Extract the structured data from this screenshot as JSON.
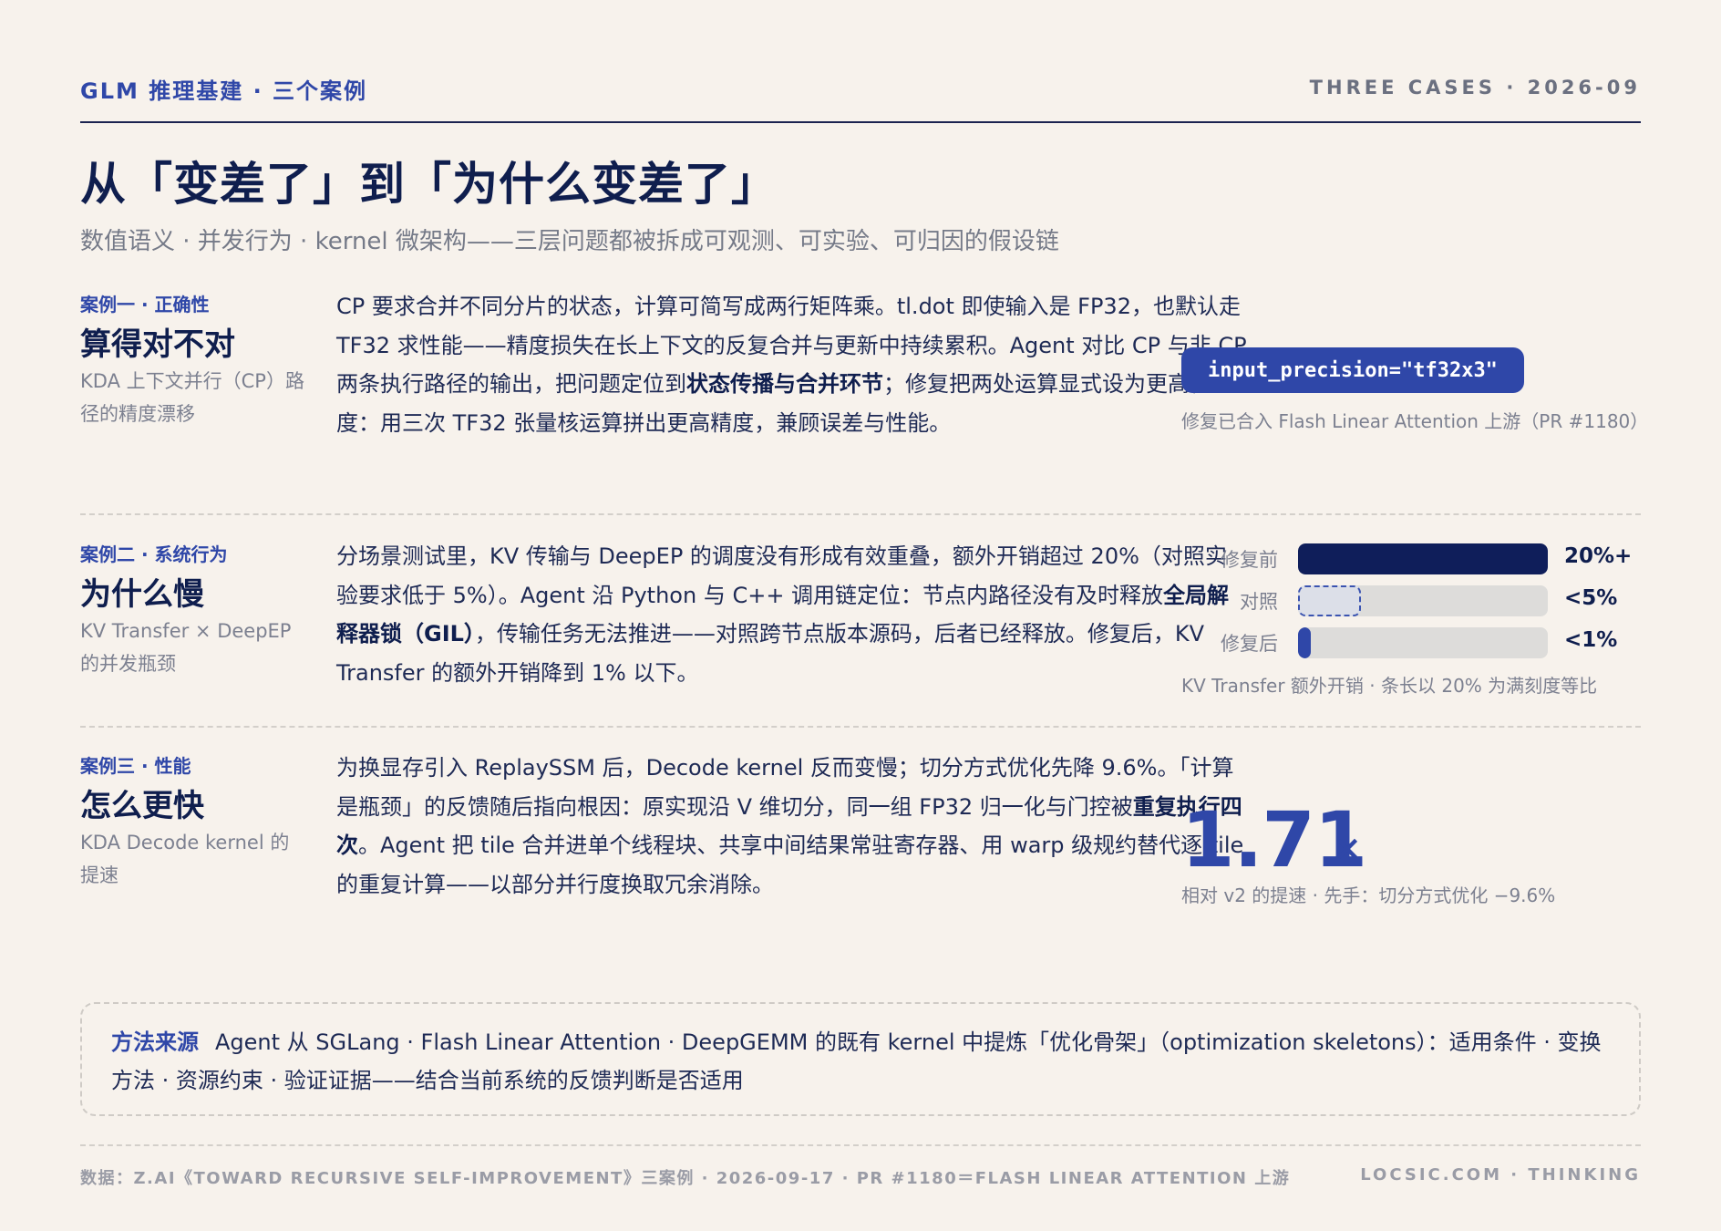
{
  "header": {
    "left": "GLM 推理基建 · 三个案例",
    "right": "THREE CASES · 2026-09"
  },
  "title": "从「变差了」到「为什么变差了」",
  "subtitle": "数值语义 · 并发行为 · kernel 微架构——三层问题都被拆成可观测、可实验、可归因的假设链",
  "cases": [
    {
      "tag": "案例一 · 正确性",
      "name": "算得对不对",
      "desc": "KDA 上下文并行（CP）路径的精度漂移",
      "body_before": "CP 要求合并不同分片的状态，计算可简写成两行矩阵乘。tl.dot 即使输入是 FP32，也默认走 TF32 求性能——精度损失在长上下文的反复合并与更新中持续累积。Agent 对比 CP 与非 CP 两条执行路径的输出，把问题定位到",
      "body_bold": "状态传播与合并环节",
      "body_after": "；修复把两处运算显式设为更高精度：用三次 TF32 张量核运算拼出更高精度，兼顾误差与性能。",
      "code": "input_precision=\"tf32x3\"",
      "note": "修复已合入 Flash Linear Attention 上游（PR #1180）"
    },
    {
      "tag": "案例二 · 系统行为",
      "name": "为什么慢",
      "desc": "KV Transfer × DeepEP 的并发瓶颈",
      "body_before": "分场景测试里，KV 传输与 DeepEP 的调度没有形成有效重叠，额外开销超过 20%（对照实验要求低于 5%）。Agent 沿 Python 与 C++ 调用链定位：节点内路径没有及时释放",
      "body_bold": "全局解释器锁（GIL）",
      "body_after": "，传输任务无法推进——对照跨节点版本源码，后者已经释放。修复后，KV Transfer 的额外开销降到 1% 以下。",
      "bars": [
        {
          "label": "修复前",
          "value": 20,
          "display": "20%+",
          "style": "solid",
          "color": "#0f1e5a"
        },
        {
          "label": "对照",
          "value": 5,
          "display": "<5%",
          "style": "dashed",
          "color": "#3a53b0"
        },
        {
          "label": "修复后",
          "value": 1,
          "display": "<1%",
          "style": "solid",
          "color": "#2f47a8"
        }
      ],
      "bar_scale_max": 20,
      "note": "KV Transfer 额外开销 · 条长以 20% 为满刻度等比"
    },
    {
      "tag": "案例三 · 性能",
      "name": "怎么更快",
      "desc": "KDA Decode kernel 的提速",
      "body_before": "为换显存引入 ReplaySSM 后，Decode kernel 反而变慢；切分方式优化先降 9.6%。「计算是瓶颈」的反馈随后指向根因：原实现沿 V 维切分，同一组 FP32 归一化与门控被",
      "body_bold": "重复执行四次",
      "body_after": "。Agent 把 tile 合并进单个线程块、共享中间结果常驻寄存器、用 warp 级规约替代逐 tile 的重复计算——以部分并行度换取冗余消除。",
      "big_number": "1.71",
      "big_unit": "×",
      "note": "相对 v2 的提速 · 先手：切分方式优化 −9.6%"
    }
  ],
  "method": {
    "label": "方法来源",
    "text": "Agent 从 SGLang · Flash Linear Attention · DeepGEMM 的既有 kernel 中提炼「优化骨架」（optimization skeletons）：适用条件 · 变换方法 · 资源约束 · 验证证据——结合当前系统的反馈判断是否适用"
  },
  "footer": {
    "left": "数据：Z.AI《TOWARD RECURSIVE SELF-IMPROVEMENT》三案例 · 2026-09-17 · PR #1180＝FLASH LINEAR ATTENTION 上游",
    "right": "LOCSIC.COM · THINKING"
  }
}
